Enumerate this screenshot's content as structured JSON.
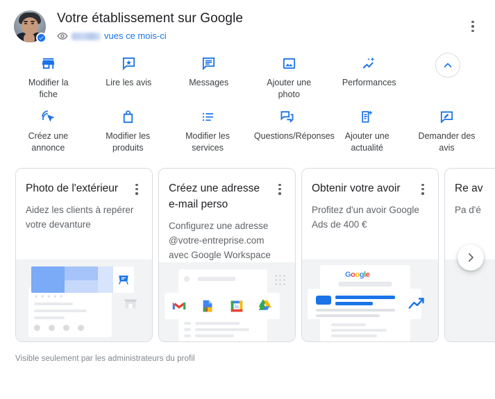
{
  "header": {
    "title": "Votre établissement sur Google",
    "views_redacted": "",
    "views_label": "vues ce mois-ci",
    "eye_icon": "eye-icon",
    "verified_icon": "verified-check-icon",
    "menu_icon": "more-vert-icon"
  },
  "actions": {
    "row1": [
      {
        "label": "Modifier la fiche",
        "icon": "storefront-icon"
      },
      {
        "label": "Lire les avis",
        "icon": "review-star-icon"
      },
      {
        "label": "Messages",
        "icon": "message-icon"
      },
      {
        "label": "Ajouter une photo",
        "icon": "add-photo-icon"
      },
      {
        "label": "Performances",
        "icon": "performance-chart-icon"
      }
    ],
    "collapse": {
      "label": "",
      "icon": "chevron-up-icon"
    },
    "row2": [
      {
        "label": "Créez une annonce",
        "icon": "ads-click-icon"
      },
      {
        "label": "Modifier les produits",
        "icon": "shopping-bag-icon"
      },
      {
        "label": "Modifier les services",
        "icon": "list-icon"
      },
      {
        "label": "Questions/Réponses",
        "icon": "forum-icon"
      },
      {
        "label": "Ajouter une actualité",
        "icon": "post-add-icon"
      },
      {
        "label": "Demander des avis",
        "icon": "request-review-icon"
      }
    ]
  },
  "cards": [
    {
      "title": "Photo de l'extérieur",
      "desc": "Aidez les clients à repérer votre devanture",
      "menu_icon": "more-vert-icon",
      "illustration": "storefront-photo-illustration"
    },
    {
      "title": "Créez une adresse e-mail perso",
      "desc": "Configurez une adresse @votre-entreprise.com avec Google Workspace",
      "menu_icon": "more-vert-icon",
      "illustration": "google-workspace-apps-illustration"
    },
    {
      "title": "Obtenir votre avoir",
      "desc": "Profitez d'un avoir Google Ads de 400 €",
      "menu_icon": "more-vert-icon",
      "illustration": "google-ads-credit-illustration"
    },
    {
      "title": "Re av",
      "desc": "Pa d'é",
      "menu_icon": "more-vert-icon",
      "illustration": "partial-card-illustration"
    }
  ],
  "carousel": {
    "next_icon": "chevron-right-icon"
  },
  "footer": {
    "note": "Visible seulement par les administrateurs du profil"
  },
  "colors": {
    "google_blue": "#1a73e8",
    "text_primary": "#202124",
    "text_secondary": "#5f6368",
    "border": "#dadce0",
    "illustration_bg": "#f1f3f4"
  }
}
